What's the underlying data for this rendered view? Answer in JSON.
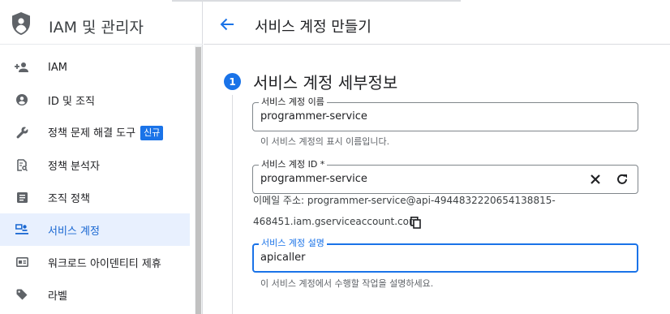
{
  "sidebar": {
    "title": "IAM 및 관리자",
    "items": [
      {
        "label": "IAM",
        "icon": "add-person-icon"
      },
      {
        "label": "ID 및 조직",
        "icon": "account-circle-icon"
      },
      {
        "label": "정책 문제 해결 도구",
        "icon": "wrench-icon",
        "badge": "신규"
      },
      {
        "label": "정책 분석자",
        "icon": "document-search-icon"
      },
      {
        "label": "조직 정책",
        "icon": "list-icon"
      },
      {
        "label": "서비스 계정",
        "icon": "service-account-icon",
        "active": true
      },
      {
        "label": "워크로드 아이덴티티 제휴",
        "icon": "id-card-icon"
      },
      {
        "label": "라벨",
        "icon": "tag-icon"
      }
    ]
  },
  "header": {
    "title": "서비스 계정 만들기"
  },
  "step": {
    "number": "1",
    "title": "서비스 계정 세부정보"
  },
  "form": {
    "name": {
      "label": "서비스 계정 이름",
      "value": "programmer-service",
      "hint": "이 서비스 계정의 표시 이름입니다."
    },
    "id": {
      "label": "서비스 계정 ID *",
      "value": "programmer-service"
    },
    "email_line1": "이메일 주소: programmer-service@api-4944832220654138815-",
    "email_line2": "468451.iam.gserviceaccount.com",
    "description": {
      "label": "서비스 계정 설명",
      "value": "apicaller",
      "hint": "이 서비스 계정에서 수행할 작업을 설명하세요."
    }
  },
  "colors": {
    "accent": "#1a73e8",
    "active_bg": "#e8f0fe"
  }
}
